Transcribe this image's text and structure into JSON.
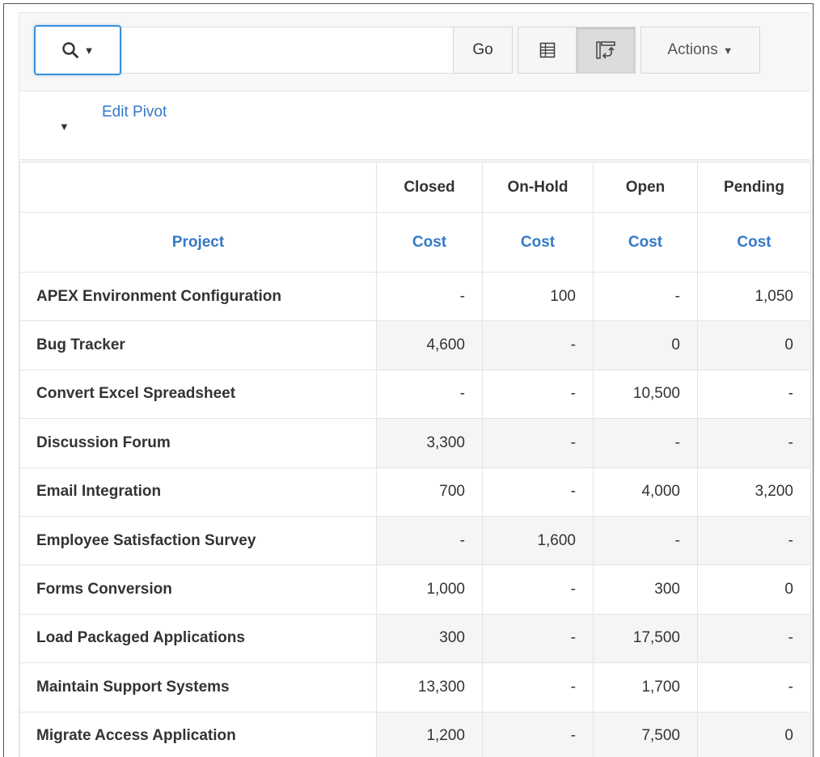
{
  "toolbar": {
    "search_placeholder": "",
    "go_label": "Go",
    "actions_label": "Actions",
    "actions_caret": "▼",
    "search_caret": "▼",
    "views": [
      {
        "name": "view-report-icon",
        "active": false
      },
      {
        "name": "view-pivot-icon",
        "active": true
      }
    ]
  },
  "pivot_bar": {
    "toggle": "▼",
    "edit_label": "Edit Pivot"
  },
  "table": {
    "pivot_columns": [
      "Closed",
      "On-Hold",
      "Open",
      "Pending"
    ],
    "row_label_header": "Project",
    "value_header": "Cost",
    "rows": [
      {
        "project": "APEX Environment Configuration",
        "values": [
          "-",
          "100",
          "-",
          "1,050"
        ]
      },
      {
        "project": "Bug Tracker",
        "values": [
          "4,600",
          "-",
          "0",
          "0"
        ]
      },
      {
        "project": "Convert Excel Spreadsheet",
        "values": [
          "-",
          "-",
          "10,500",
          "-"
        ]
      },
      {
        "project": "Discussion Forum",
        "values": [
          "3,300",
          "-",
          "-",
          "-"
        ]
      },
      {
        "project": "Email Integration",
        "values": [
          "700",
          "-",
          "4,000",
          "3,200"
        ]
      },
      {
        "project": "Employee Satisfaction Survey",
        "values": [
          "-",
          "1,600",
          "-",
          "-"
        ]
      },
      {
        "project": "Forms Conversion",
        "values": [
          "1,000",
          "-",
          "300",
          "0"
        ]
      },
      {
        "project": "Load Packaged Applications",
        "values": [
          "300",
          "-",
          "17,500",
          "-"
        ]
      },
      {
        "project": "Maintain Support Systems",
        "values": [
          "13,300",
          "-",
          "1,700",
          "-"
        ]
      },
      {
        "project": "Migrate Access Application",
        "values": [
          "1,200",
          "-",
          "7,500",
          "0"
        ]
      }
    ]
  },
  "colors": {
    "accent": "#3579c8",
    "focus": "#3b8fdc"
  }
}
